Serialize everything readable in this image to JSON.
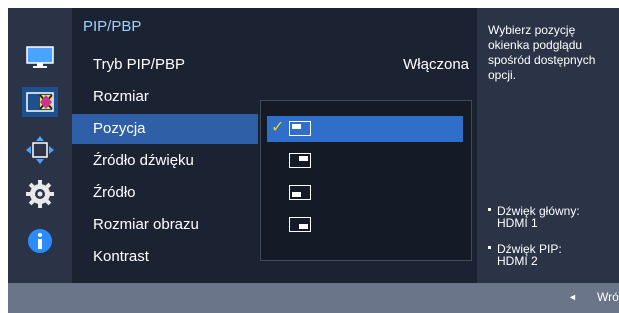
{
  "rail": {
    "icons": [
      "monitor-icon",
      "color-icon",
      "move-icon",
      "gear-icon",
      "info-icon"
    ]
  },
  "menu": {
    "title": "PIP/PBP",
    "items": [
      {
        "label": "Tryb PIP/PBP",
        "value": "Włączona"
      },
      {
        "label": "Rozmiar",
        "value": ""
      },
      {
        "label": "Pozycja",
        "value": ""
      },
      {
        "label": "Źródło dźwięku",
        "value": ""
      },
      {
        "label": "Źródło",
        "value": ""
      },
      {
        "label": "Rozmiar obrazu",
        "value": ""
      },
      {
        "label": "Kontrast",
        "value": ""
      }
    ],
    "selected_item": "Pozycja"
  },
  "position_options": {
    "icons": [
      "pip-top-left-icon",
      "pip-top-right-icon",
      "pip-bottom-left-icon",
      "pip-bottom-right-icon"
    ],
    "selected_index": 0
  },
  "help": {
    "description": "Wybierz pozycję okienka podglądu spośród dostępnych opcji.",
    "info": [
      {
        "label": "Dźwięk główny:",
        "value": "HDMI 1"
      },
      {
        "label": "Dźwięk PIP:",
        "value": "HDMI 2"
      }
    ]
  },
  "bottom": {
    "back_label": "Wró"
  },
  "colors": {
    "menu_bg": "#1b2333",
    "highlight": "#2f5fa6",
    "option_selected": "#2f6fca",
    "title": "#9fd0ff",
    "check": "#f0d020",
    "frame": "#6a7589"
  }
}
